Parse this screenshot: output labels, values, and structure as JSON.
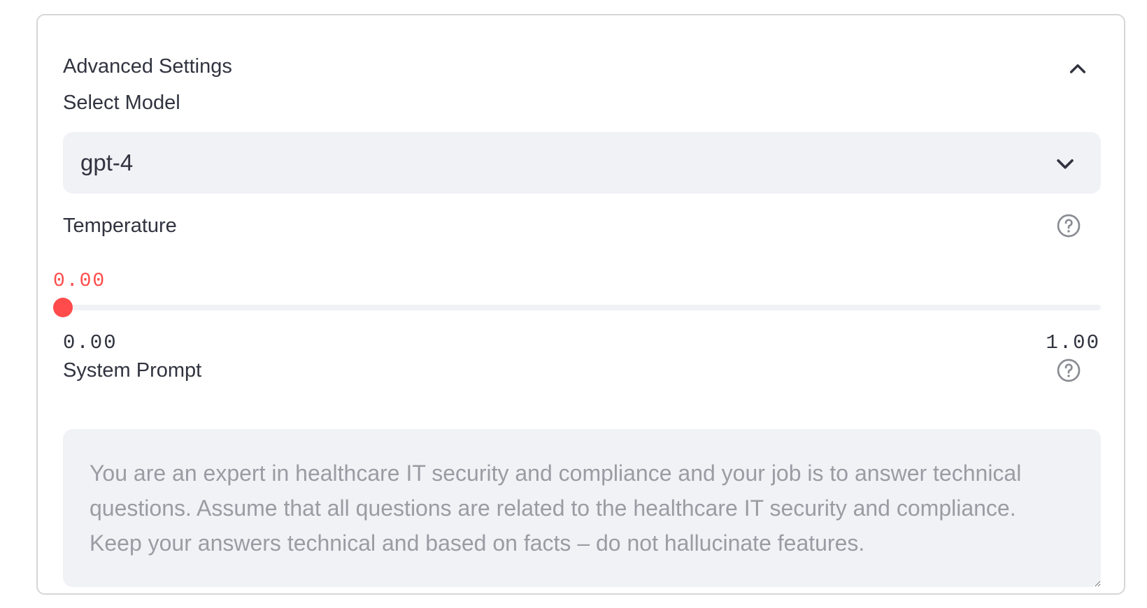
{
  "expander": {
    "title": "Advanced Settings",
    "toggle_icon": "chevron-up-icon"
  },
  "model_select": {
    "label": "Select Model",
    "value": "gpt-4",
    "icon": "chevron-down-icon"
  },
  "temperature": {
    "label": "Temperature",
    "value_text": "0.00",
    "value": 0.0,
    "min": 0.0,
    "max": 1.0,
    "min_label": "0.00",
    "max_label": "1.00",
    "help_icon": "help-circle-icon",
    "accent_color": "#ff4b4b"
  },
  "system_prompt": {
    "label": "System Prompt",
    "placeholder": "You are an expert in healthcare IT security and compliance and your job is to answer technical questions. Assume that all questions are related to the healthcare IT security and compliance. Keep your answers technical and based on facts – do not hallucinate features.",
    "help_icon": "help-circle-icon"
  }
}
